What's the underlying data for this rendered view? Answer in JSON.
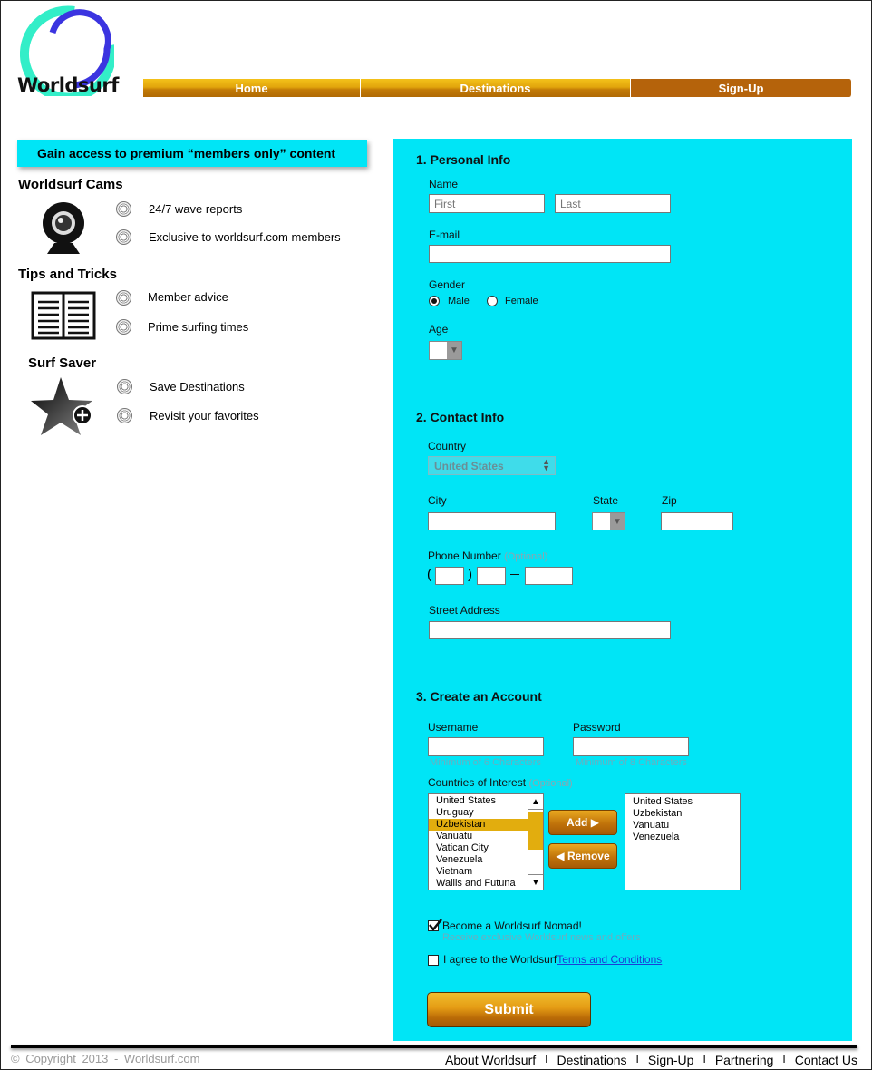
{
  "brand": {
    "logo_text": "Worldsurf"
  },
  "nav": {
    "items": [
      "Home",
      "Destinations",
      "Sign-Up"
    ]
  },
  "promo": {
    "banner": "Gain access to premium “members only” content",
    "sections": [
      {
        "title": "Worldsurf Cams",
        "icon": "webcam-icon",
        "features": [
          "24/7 wave reports",
          "Exclusive to worldsurf.com members"
        ]
      },
      {
        "title": "Tips and Tricks",
        "icon": "book-icon",
        "features": [
          "Member advice",
          "Prime surfing times"
        ]
      },
      {
        "title": "Surf Saver",
        "icon": "star-plus-icon",
        "features": [
          "Save Destinations",
          "Revisit your favorites"
        ]
      }
    ]
  },
  "form": {
    "personal": {
      "heading": "1. Personal Info",
      "name_label": "Name",
      "first_placeholder": "First",
      "last_placeholder": "Last",
      "email_label": "E-mail",
      "gender_label": "Gender",
      "gender_options": [
        "Male",
        "Female"
      ],
      "gender_selected": "Male",
      "age_label": "Age"
    },
    "contact": {
      "heading": "2. Contact Info",
      "country_label": "Country",
      "country_value": "United States",
      "city_label": "City",
      "state_label": "State",
      "zip_label": "Zip",
      "phone_label": "Phone Number",
      "phone_optional": "(Optional)",
      "street_label": "Street Address"
    },
    "account": {
      "heading": "3. Create an Account",
      "username_label": "Username",
      "username_hint": "Minimum of 6 Characters",
      "password_label": "Password",
      "password_hint": "Minimum of 8 Characters",
      "countries_label": "Countries of Interest",
      "countries_optional": "(Optional)",
      "available": [
        "United States",
        "Uruguay",
        "Uzbekistan",
        "Vanuatu",
        "Vatican City",
        "Venezuela",
        "Vietnam",
        "Wallis and Futuna"
      ],
      "available_selected": "Uzbekistan",
      "chosen": [
        "United States",
        "Uzbekistan",
        "Vanuatu",
        "Venezuela"
      ],
      "add_label": "Add ▶",
      "remove_label": "◀ Remove"
    },
    "nomad_label": "Become a Worldsurf Nomad!",
    "nomad_hint": "Receive exclusive Worldsurf news and offers",
    "nomad_checked": true,
    "agree_prefix": "I agree to the Worldsurf",
    "agree_link": "Terms and Conditions",
    "agree_checked": false,
    "submit_label": "Submit"
  },
  "footer": {
    "copyright": "©  Copyright  2013  -  Worldsurf.com",
    "links": [
      "About Worldsurf",
      "Destinations",
      "Sign-Up",
      "Partnering",
      "Contact Us"
    ],
    "separator": "I"
  }
}
